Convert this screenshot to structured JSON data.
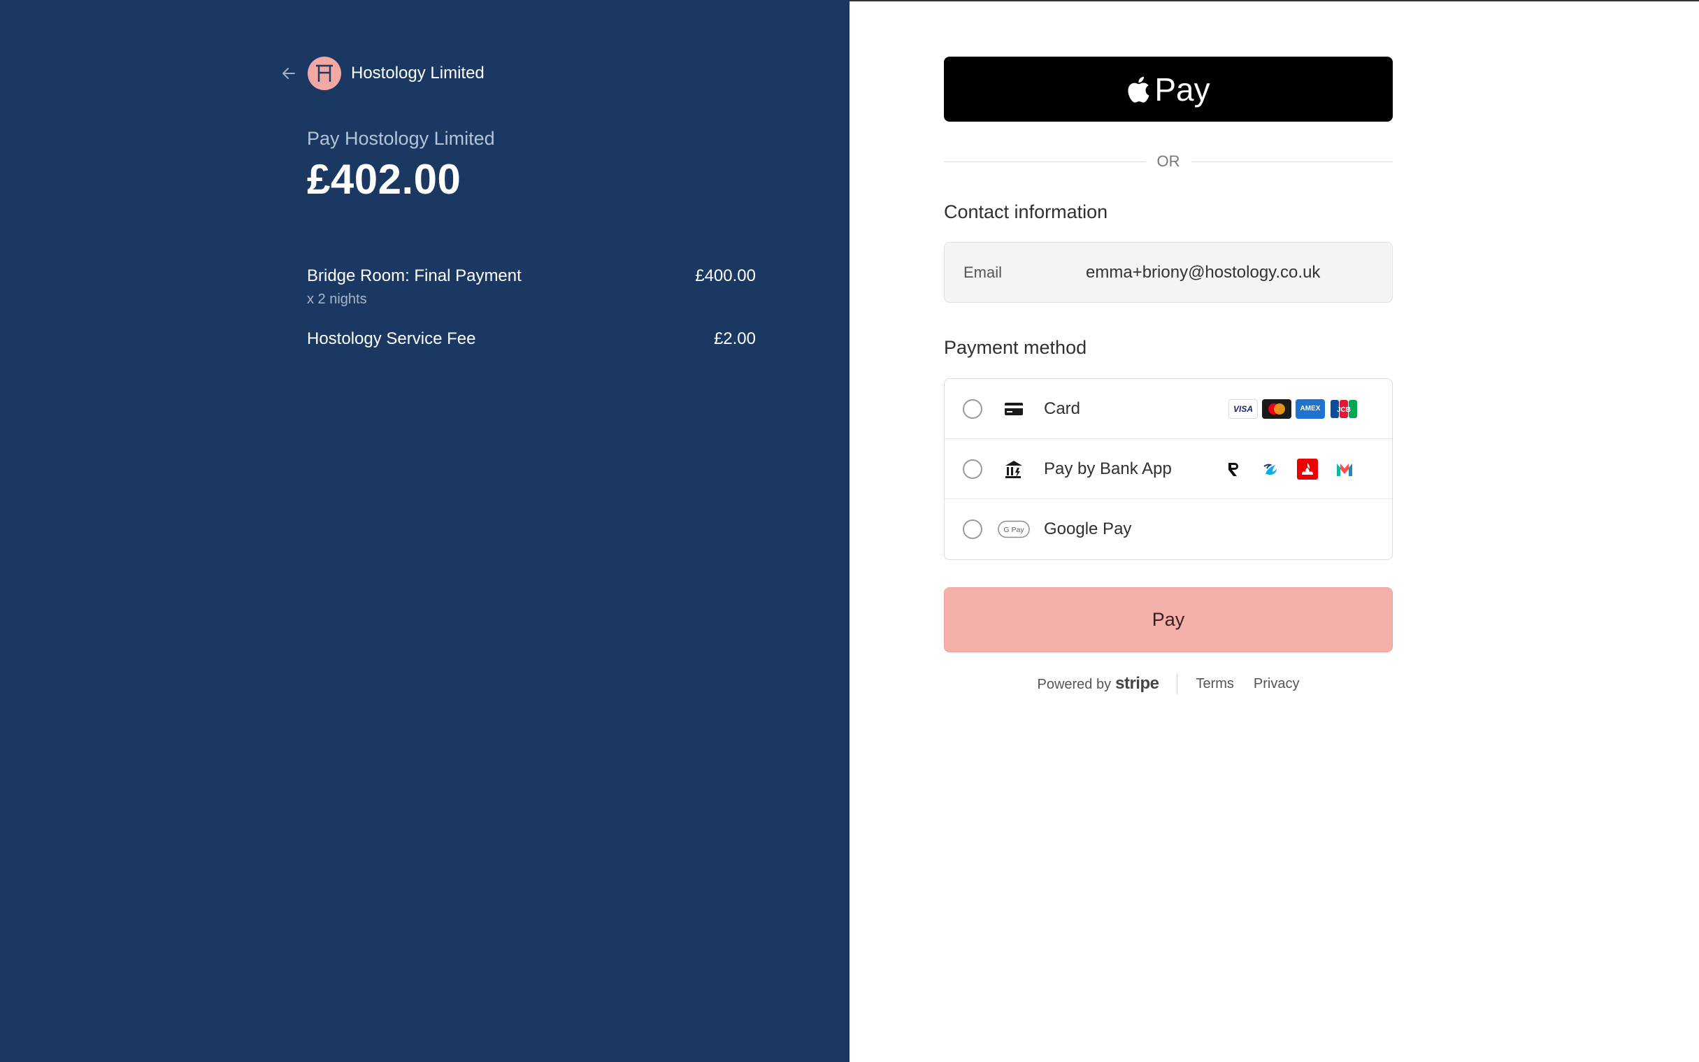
{
  "merchant": {
    "name": "Hostology Limited",
    "avatar_color": "#f2a9a4"
  },
  "summary": {
    "pay_to": "Pay Hostology Limited",
    "total": "£402.00",
    "line_items": [
      {
        "name": "Bridge Room: Final Payment",
        "sub": "x 2 nights",
        "amount": "£400.00"
      },
      {
        "name": "Hostology Service Fee",
        "sub": "",
        "amount": "£2.00"
      }
    ]
  },
  "checkout": {
    "applepay_label": "Pay",
    "or_label": "OR",
    "contact_title": "Contact information",
    "email_label": "Email",
    "email_value": "emma+briony@hostology.co.uk",
    "payment_title": "Payment method",
    "methods": [
      {
        "label": "Card",
        "icon": "card-icon",
        "brands": [
          "VISA",
          "Mastercard",
          "AMEX",
          "JCB"
        ]
      },
      {
        "label": "Pay by Bank App",
        "icon": "bank-icon",
        "banks": [
          "Revolut",
          "Barclays",
          "Santander",
          "Monzo"
        ]
      },
      {
        "label": "Google Pay",
        "icon": "google-pay-icon",
        "badge": "G Pay"
      }
    ],
    "pay_button": "Pay",
    "footer": {
      "powered_by": "Powered by",
      "stripe": "stripe",
      "terms": "Terms",
      "privacy": "Privacy"
    }
  },
  "colors": {
    "left_panel": "#1a3862",
    "pay_button": "#f5b0aa",
    "applepay": "#000000"
  }
}
